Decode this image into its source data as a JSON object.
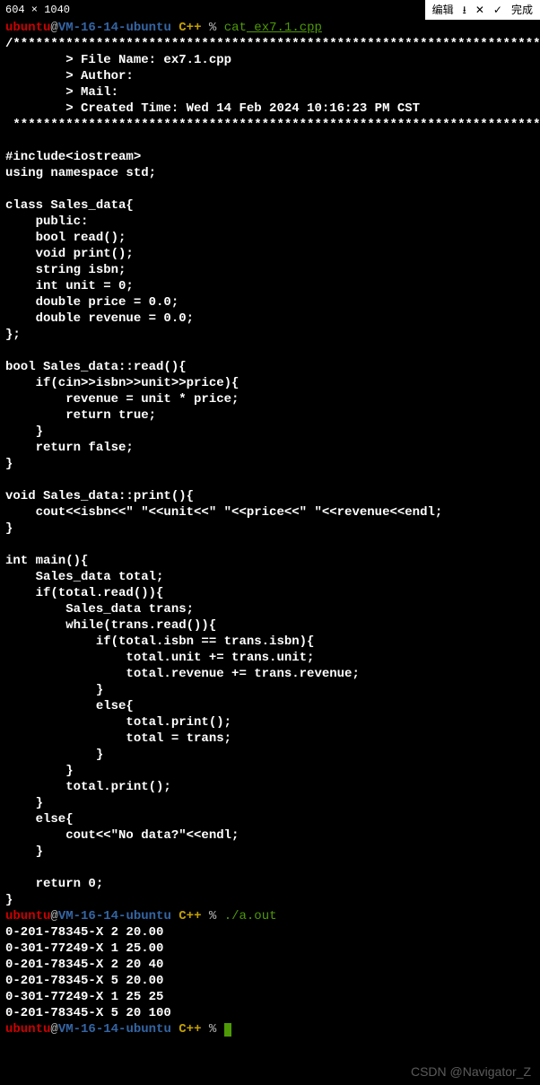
{
  "dim_label": "604 × 1040",
  "toolbar": {
    "edit": "编辑",
    "download_icon": "⭳",
    "close_icon": "✕",
    "check_icon": "✓",
    "done": "完成"
  },
  "prompt1": {
    "user": "ubuntu",
    "at": "@",
    "host": "VM-16-14-ubuntu",
    "path": " C++ ",
    "sep": "% ",
    "cmd": "cat",
    "arg": " ex7.1.cpp"
  },
  "code": "/*************************************************************************\n        > File Name: ex7.1.cpp\n        > Author:\n        > Mail:\n        > Created Time: Wed 14 Feb 2024 10:16:23 PM CST\n ************************************************************************/\n\n#include<iostream>\nusing namespace std;\n\nclass Sales_data{\n    public:\n    bool read();\n    void print();\n    string isbn;\n    int unit = 0;\n    double price = 0.0;\n    double revenue = 0.0;\n};\n\nbool Sales_data::read(){\n    if(cin>>isbn>>unit>>price){\n        revenue = unit * price;\n        return true;\n    }\n    return false;\n}\n\nvoid Sales_data::print(){\n    cout<<isbn<<\" \"<<unit<<\" \"<<price<<\" \"<<revenue<<endl;\n}\n\nint main(){\n    Sales_data total;\n    if(total.read()){\n        Sales_data trans;\n        while(trans.read()){\n            if(total.isbn == trans.isbn){\n                total.unit += trans.unit;\n                total.revenue += trans.revenue;\n            }\n            else{\n                total.print();\n                total = trans;\n            }\n        }\n        total.print();\n    }\n    else{\n        cout<<\"No data?\"<<endl;\n    }\n\n    return 0;\n}",
  "prompt2": {
    "user": "ubuntu",
    "at": "@",
    "host": "VM-16-14-ubuntu",
    "path": " C++ ",
    "sep": "% ",
    "cmd": "./a.out"
  },
  "output": "0-201-78345-X 2 20.00\n0-301-77249-X 1 25.00\n0-201-78345-X 2 20 40\n0-201-78345-X 5 20.00\n0-301-77249-X 1 25 25\n0-201-78345-X 5 20 100",
  "prompt3": {
    "user": "ubuntu",
    "at": "@",
    "host": "VM-16-14-ubuntu",
    "path": " C++ ",
    "sep": "% "
  },
  "watermark": "CSDN @Navigator_Z"
}
